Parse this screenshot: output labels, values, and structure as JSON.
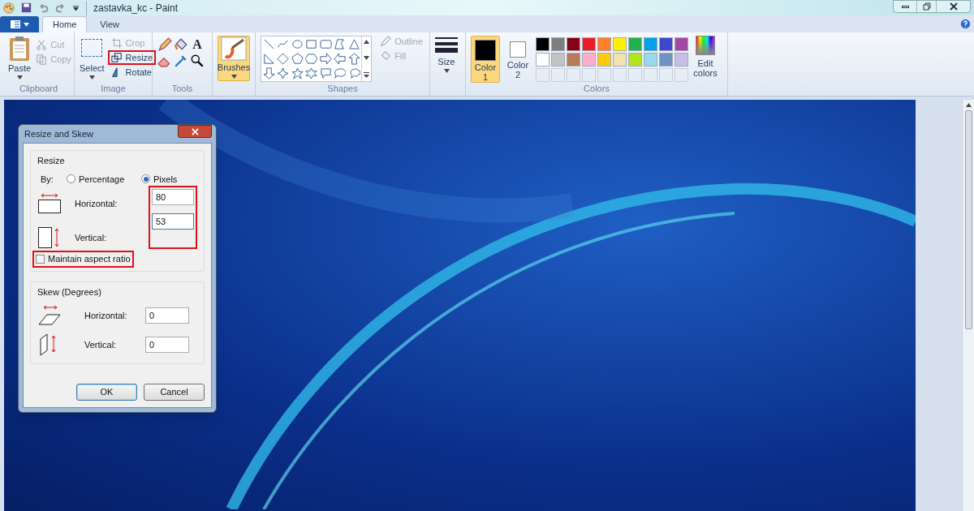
{
  "window": {
    "title": "zastavka_kc - Paint"
  },
  "tabs": [
    {
      "label": "Home",
      "selected": true
    },
    {
      "label": "View",
      "selected": false
    }
  ],
  "ribbon": {
    "clipboard": {
      "label": "Clipboard",
      "paste": "Paste",
      "cut": {
        "label": "Cut",
        "disabled": true
      },
      "copy": {
        "label": "Copy",
        "disabled": true
      }
    },
    "image": {
      "label": "Image",
      "select": "Select",
      "crop": {
        "label": "Crop",
        "disabled": true,
        "annotated": false
      },
      "resize": {
        "label": "Resize",
        "disabled": false,
        "annotated": true
      },
      "rotate": {
        "label": "Rotate",
        "disabled": false,
        "annotated": false
      }
    },
    "tools": {
      "label": "Tools",
      "text_glyph": "A"
    },
    "brushes": {
      "label": "Brushes",
      "selected": true
    },
    "shapes": {
      "label": "Shapes",
      "outline": {
        "label": "Outline",
        "disabled": true
      },
      "fill": {
        "label": "Fill",
        "disabled": true
      }
    },
    "size": {
      "label": "Size"
    },
    "colors": {
      "label": "Colors",
      "slots": [
        {
          "label": "Color 1",
          "color": "#000000",
          "selected": true
        },
        {
          "label": "Color 2",
          "color": "#ffffff",
          "selected": false
        }
      ],
      "palette": [
        {
          "color": "#000000"
        },
        {
          "color": "#7f7f7f"
        },
        {
          "color": "#880015"
        },
        {
          "color": "#ed1c24"
        },
        {
          "color": "#ff7f27"
        },
        {
          "color": "#fff200"
        },
        {
          "color": "#22b14c"
        },
        {
          "color": "#00a2e8"
        },
        {
          "color": "#3f48cc"
        },
        {
          "color": "#a349a4"
        },
        {
          "color": "#ffffff"
        },
        {
          "color": "#c3c3c3"
        },
        {
          "color": "#b97a57"
        },
        {
          "color": "#ffaec9"
        },
        {
          "color": "#ffc90e"
        },
        {
          "color": "#efe4b0"
        },
        {
          "color": "#b5e61d"
        },
        {
          "color": "#99d9ea"
        },
        {
          "color": "#7092be"
        },
        {
          "color": "#c8bfe7"
        }
      ],
      "edit": "Edit colors"
    }
  },
  "dialog": {
    "title": "Resize and Skew",
    "resize": {
      "label": "Resize",
      "by": "By:",
      "options": [
        {
          "label": "Percentage",
          "selected": false
        },
        {
          "label": "Pixels",
          "selected": true
        }
      ],
      "fields_annotated": true,
      "horizontal": {
        "label": "Horizontal:",
        "value": "80"
      },
      "vertical": {
        "label": "Vertical:",
        "value": "53"
      },
      "maintain": {
        "label": "Maintain aspect ratio",
        "checked": false,
        "annotated": true
      }
    },
    "skew": {
      "label": "Skew (Degrees)",
      "horizontal": {
        "label": "Horizontal:",
        "value": "0"
      },
      "vertical": {
        "label": "Vertical:",
        "value": "0"
      }
    },
    "buttons": [
      "OK",
      "Cancel"
    ]
  }
}
